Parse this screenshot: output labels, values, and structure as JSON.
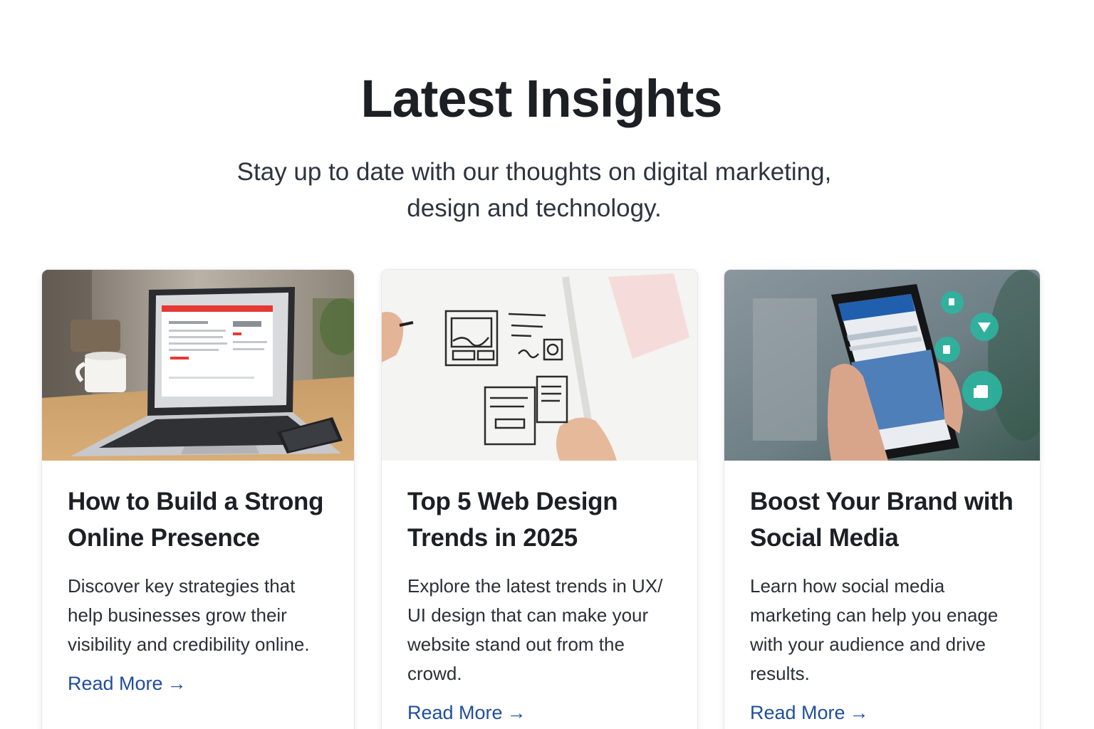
{
  "section": {
    "title": "Latest Insights",
    "subtitle": "Stay up to date with our thoughts on digital marketing, design and technology."
  },
  "posts": [
    {
      "title": "How to Build a Strong Online Presence",
      "excerpt": "Discover key strategies that help businesses grow their visibility and credibility online.",
      "link_label": "Read More",
      "link_arrow": "→",
      "image_icon": "laptop-photo"
    },
    {
      "title": "Top 5 Web Design Trends in 2025",
      "excerpt": "Explore the latest trends in UX/ UI design that can make your website stand out from the crowd.",
      "link_label": "Read More",
      "link_arrow": "→",
      "image_icon": "wireframe-sketch-photo"
    },
    {
      "title": "Boost Your Brand with Social Media",
      "excerpt": "Learn how social media marketing can help you enage with your audience and drive results.",
      "link_label": "Read More",
      "link_arrow": "→",
      "image_icon": "smartphone-social-photo"
    }
  ],
  "colors": {
    "heading": "#1c1f24",
    "body_text": "#2b2f36",
    "link": "#1f4e9c",
    "card_border": "#e6e8ec",
    "accent_red": "#e53935",
    "accent_teal": "#2bb5a0"
  }
}
